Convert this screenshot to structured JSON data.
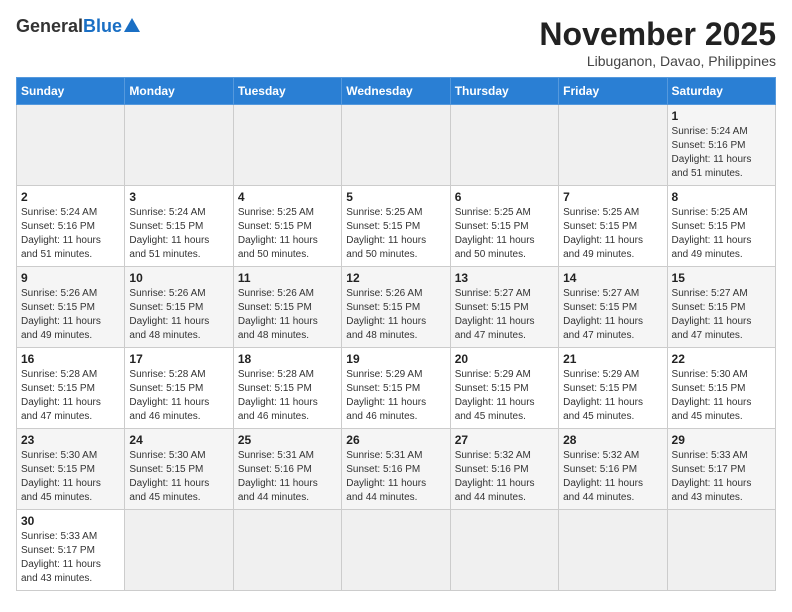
{
  "header": {
    "logo": {
      "general": "General",
      "blue": "Blue",
      "subtitle": ""
    },
    "title": "November 2025",
    "location": "Libuganon, Davao, Philippines"
  },
  "weekdays": [
    "Sunday",
    "Monday",
    "Tuesday",
    "Wednesday",
    "Thursday",
    "Friday",
    "Saturday"
  ],
  "weeks": [
    [
      {
        "day": "",
        "info": ""
      },
      {
        "day": "",
        "info": ""
      },
      {
        "day": "",
        "info": ""
      },
      {
        "day": "",
        "info": ""
      },
      {
        "day": "",
        "info": ""
      },
      {
        "day": "",
        "info": ""
      },
      {
        "day": "1",
        "info": "Sunrise: 5:24 AM\nSunset: 5:16 PM\nDaylight: 11 hours\nand 51 minutes."
      }
    ],
    [
      {
        "day": "2",
        "info": "Sunrise: 5:24 AM\nSunset: 5:16 PM\nDaylight: 11 hours\nand 51 minutes."
      },
      {
        "day": "3",
        "info": "Sunrise: 5:24 AM\nSunset: 5:15 PM\nDaylight: 11 hours\nand 51 minutes."
      },
      {
        "day": "4",
        "info": "Sunrise: 5:25 AM\nSunset: 5:15 PM\nDaylight: 11 hours\nand 50 minutes."
      },
      {
        "day": "5",
        "info": "Sunrise: 5:25 AM\nSunset: 5:15 PM\nDaylight: 11 hours\nand 50 minutes."
      },
      {
        "day": "6",
        "info": "Sunrise: 5:25 AM\nSunset: 5:15 PM\nDaylight: 11 hours\nand 50 minutes."
      },
      {
        "day": "7",
        "info": "Sunrise: 5:25 AM\nSunset: 5:15 PM\nDaylight: 11 hours\nand 49 minutes."
      },
      {
        "day": "8",
        "info": "Sunrise: 5:25 AM\nSunset: 5:15 PM\nDaylight: 11 hours\nand 49 minutes."
      }
    ],
    [
      {
        "day": "9",
        "info": "Sunrise: 5:26 AM\nSunset: 5:15 PM\nDaylight: 11 hours\nand 49 minutes."
      },
      {
        "day": "10",
        "info": "Sunrise: 5:26 AM\nSunset: 5:15 PM\nDaylight: 11 hours\nand 48 minutes."
      },
      {
        "day": "11",
        "info": "Sunrise: 5:26 AM\nSunset: 5:15 PM\nDaylight: 11 hours\nand 48 minutes."
      },
      {
        "day": "12",
        "info": "Sunrise: 5:26 AM\nSunset: 5:15 PM\nDaylight: 11 hours\nand 48 minutes."
      },
      {
        "day": "13",
        "info": "Sunrise: 5:27 AM\nSunset: 5:15 PM\nDaylight: 11 hours\nand 47 minutes."
      },
      {
        "day": "14",
        "info": "Sunrise: 5:27 AM\nSunset: 5:15 PM\nDaylight: 11 hours\nand 47 minutes."
      },
      {
        "day": "15",
        "info": "Sunrise: 5:27 AM\nSunset: 5:15 PM\nDaylight: 11 hours\nand 47 minutes."
      }
    ],
    [
      {
        "day": "16",
        "info": "Sunrise: 5:28 AM\nSunset: 5:15 PM\nDaylight: 11 hours\nand 47 minutes."
      },
      {
        "day": "17",
        "info": "Sunrise: 5:28 AM\nSunset: 5:15 PM\nDaylight: 11 hours\nand 46 minutes."
      },
      {
        "day": "18",
        "info": "Sunrise: 5:28 AM\nSunset: 5:15 PM\nDaylight: 11 hours\nand 46 minutes."
      },
      {
        "day": "19",
        "info": "Sunrise: 5:29 AM\nSunset: 5:15 PM\nDaylight: 11 hours\nand 46 minutes."
      },
      {
        "day": "20",
        "info": "Sunrise: 5:29 AM\nSunset: 5:15 PM\nDaylight: 11 hours\nand 45 minutes."
      },
      {
        "day": "21",
        "info": "Sunrise: 5:29 AM\nSunset: 5:15 PM\nDaylight: 11 hours\nand 45 minutes."
      },
      {
        "day": "22",
        "info": "Sunrise: 5:30 AM\nSunset: 5:15 PM\nDaylight: 11 hours\nand 45 minutes."
      }
    ],
    [
      {
        "day": "23",
        "info": "Sunrise: 5:30 AM\nSunset: 5:15 PM\nDaylight: 11 hours\nand 45 minutes."
      },
      {
        "day": "24",
        "info": "Sunrise: 5:30 AM\nSunset: 5:15 PM\nDaylight: 11 hours\nand 45 minutes."
      },
      {
        "day": "25",
        "info": "Sunrise: 5:31 AM\nSunset: 5:16 PM\nDaylight: 11 hours\nand 44 minutes."
      },
      {
        "day": "26",
        "info": "Sunrise: 5:31 AM\nSunset: 5:16 PM\nDaylight: 11 hours\nand 44 minutes."
      },
      {
        "day": "27",
        "info": "Sunrise: 5:32 AM\nSunset: 5:16 PM\nDaylight: 11 hours\nand 44 minutes."
      },
      {
        "day": "28",
        "info": "Sunrise: 5:32 AM\nSunset: 5:16 PM\nDaylight: 11 hours\nand 44 minutes."
      },
      {
        "day": "29",
        "info": "Sunrise: 5:33 AM\nSunset: 5:17 PM\nDaylight: 11 hours\nand 43 minutes."
      }
    ],
    [
      {
        "day": "30",
        "info": "Sunrise: 5:33 AM\nSunset: 5:17 PM\nDaylight: 11 hours\nand 43 minutes."
      },
      {
        "day": "",
        "info": ""
      },
      {
        "day": "",
        "info": ""
      },
      {
        "day": "",
        "info": ""
      },
      {
        "day": "",
        "info": ""
      },
      {
        "day": "",
        "info": ""
      },
      {
        "day": "",
        "info": ""
      }
    ]
  ]
}
